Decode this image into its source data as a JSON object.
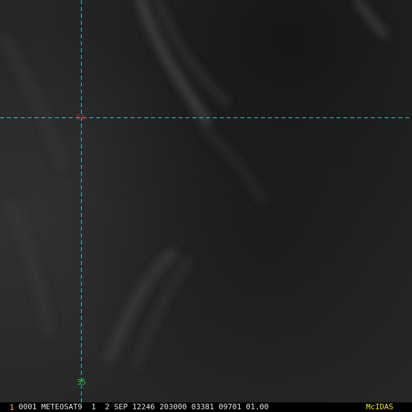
{
  "map": {
    "latitude_label": "50",
    "longitude_label": "35",
    "colors": {
      "background": "#1c1c1c",
      "grid_line": "#3ec8d6",
      "latitude_label": "#c8201e",
      "longitude_label": "#31d12a",
      "status_text": "#e8e8e8",
      "frame_number": "#f2d21b",
      "brand": "#f2e81b"
    }
  },
  "status_bar": {
    "frame_number": "1",
    "image_info": "0001 METEOSAT9  1  2 SEP 12246 203000 03381 09701 01.00",
    "brand": "McIDAS"
  }
}
